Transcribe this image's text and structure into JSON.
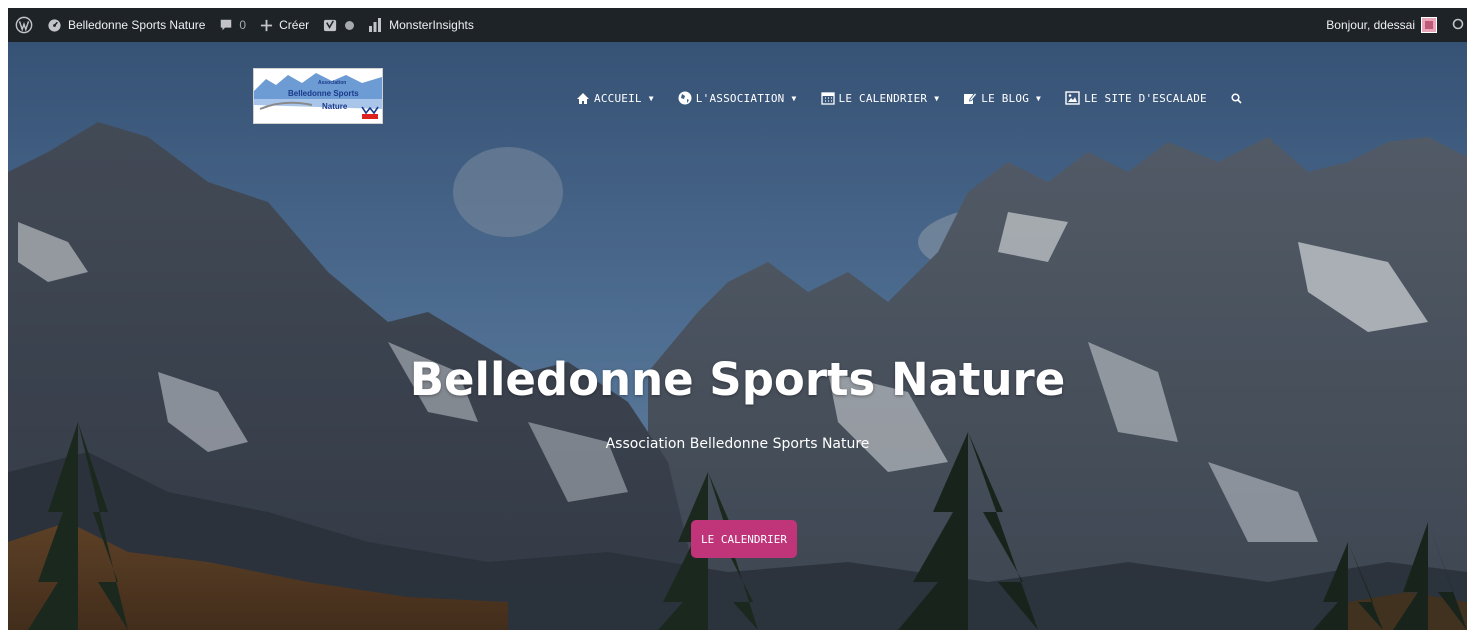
{
  "admin_bar": {
    "wp_logo_icon": "wordpress-icon",
    "site_name": "Belledonne Sports Nature",
    "comments_count": "0",
    "create_label": "Créer",
    "plugin_label": "MonsterInsights",
    "greeting": "Bonjour, ddessai",
    "status_dot_color": "#a7aaad"
  },
  "logo": {
    "line1": "Association",
    "line2": "Belledonne Sports",
    "line3": "Nature"
  },
  "nav": {
    "items": [
      {
        "label": "ACCUEIL",
        "icon": "home-icon"
      },
      {
        "label": "L'ASSOCIATION",
        "icon": "globe-icon"
      },
      {
        "label": "LE CALENDRIER",
        "icon": "calendar-icon"
      },
      {
        "label": "LE BLOG",
        "icon": "edit-icon"
      },
      {
        "label": "LE SITE D'ESCALADE",
        "icon": "image-icon"
      }
    ],
    "search_icon": "search-icon"
  },
  "hero": {
    "title": "Belledonne Sports Nature",
    "subtitle": "Association Belledonne Sports Nature",
    "cta_label": "LE CALENDRIER",
    "cta_color": "#c0347a"
  }
}
